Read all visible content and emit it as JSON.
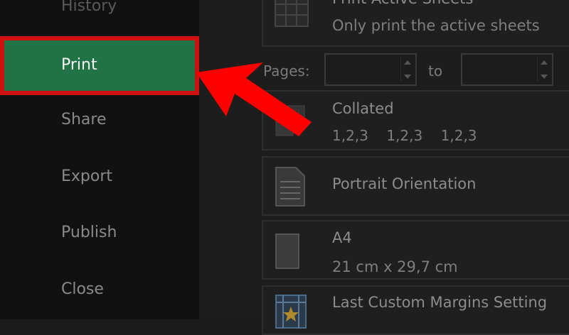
{
  "nav": {
    "history": "History",
    "print": "Print",
    "share": "Share",
    "export": "Export",
    "publish": "Publish",
    "close": "Close"
  },
  "settings": {
    "active_sheets": {
      "title": "Print Active Sheets",
      "subtitle": "Only print the active sheets"
    },
    "pages": {
      "label": "Pages:",
      "to": "to",
      "from_value": "",
      "to_value": ""
    },
    "collated": {
      "title": "Collated",
      "subtitle": "1,2,3    1,2,3    1,2,3"
    },
    "orientation": {
      "title": "Portrait Orientation"
    },
    "paper": {
      "title": "A4",
      "subtitle": "21 cm x 29,7 cm"
    },
    "margins": {
      "title": "Last Custom Margins Setting"
    }
  },
  "colors": {
    "highlight_border": "#d00f0f",
    "print_bg": "#217346",
    "arrow": "#ff0000"
  },
  "icons": [
    "sheets-grid-icon",
    "collate-pages-icon",
    "portrait-page-icon",
    "paper-size-icon",
    "margins-icon",
    "pointer-arrow-icon"
  ]
}
